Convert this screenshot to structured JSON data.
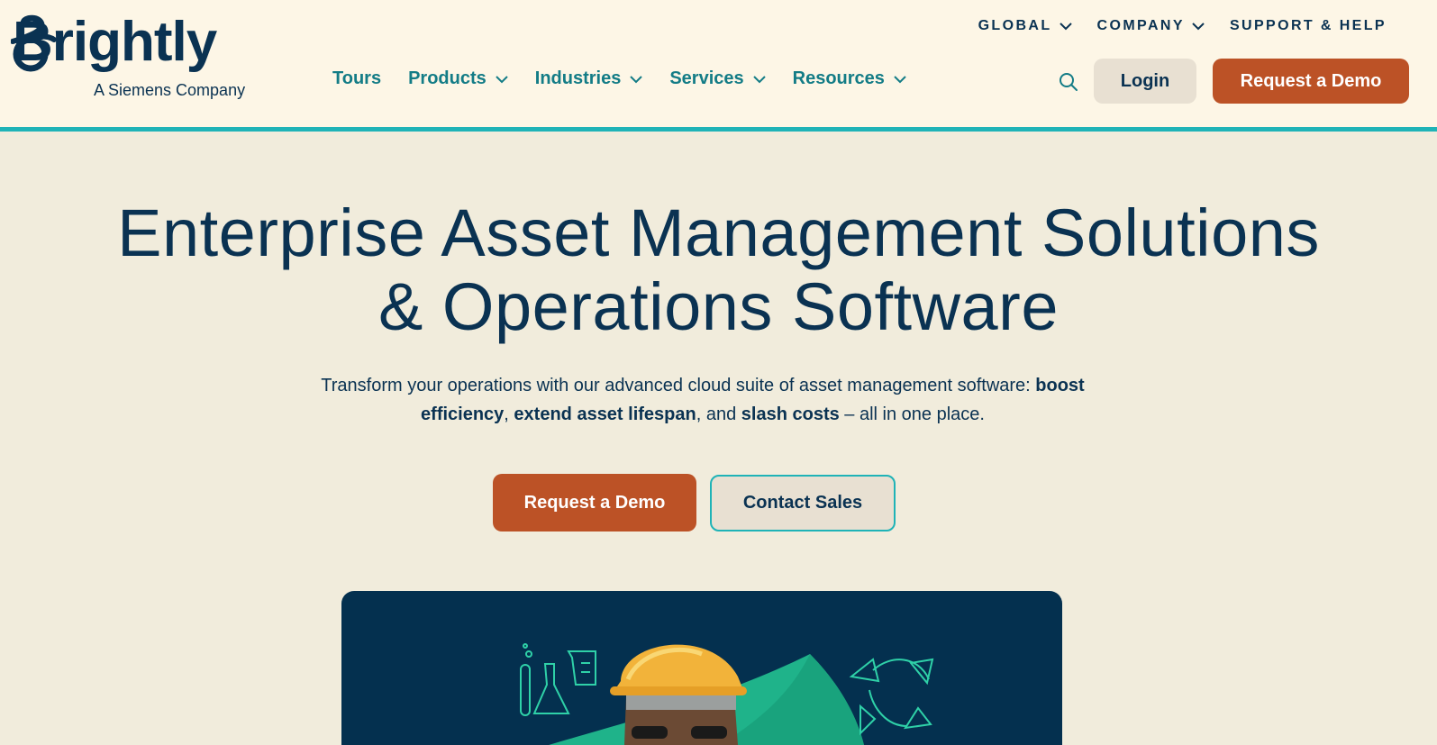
{
  "brand": {
    "name": "Brightly",
    "tagline": "A Siemens Company"
  },
  "top_nav": [
    {
      "label": "GLOBAL",
      "dropdown": true
    },
    {
      "label": "COMPANY",
      "dropdown": true
    },
    {
      "label": "SUPPORT & HELP",
      "dropdown": false
    }
  ],
  "main_nav": [
    {
      "label": "Tours",
      "dropdown": false
    },
    {
      "label": "Products",
      "dropdown": true
    },
    {
      "label": "Industries",
      "dropdown": true
    },
    {
      "label": "Services",
      "dropdown": true
    },
    {
      "label": "Resources",
      "dropdown": true
    }
  ],
  "header_actions": {
    "search_icon": "search-icon",
    "login_label": "Login",
    "demo_label": "Request a Demo"
  },
  "hero": {
    "title_line1": "Enterprise Asset Management Solutions",
    "title_line2": "& Operations Software",
    "desc_part1": "Transform your operations with our advanced cloud suite of asset management software: ",
    "desc_bold1": "boost efficiency",
    "desc_sep1": ", ",
    "desc_bold2": "extend asset lifespan",
    "desc_sep2": ", and ",
    "desc_bold3": "slash costs",
    "desc_part2": " – all in one place.",
    "cta_primary": "Request a Demo",
    "cta_secondary": "Contact Sales"
  },
  "colors": {
    "navy": "#0a3252",
    "teal": "#137c86",
    "accent_teal": "#1fb3b7",
    "orange": "#bc5226",
    "header_bg": "#fdf6e6",
    "page_bg": "#f1ecdc"
  },
  "media": {
    "icons": [
      "lab-flask-icon",
      "recycle-icon"
    ],
    "subject": "worker-hard-hat"
  }
}
